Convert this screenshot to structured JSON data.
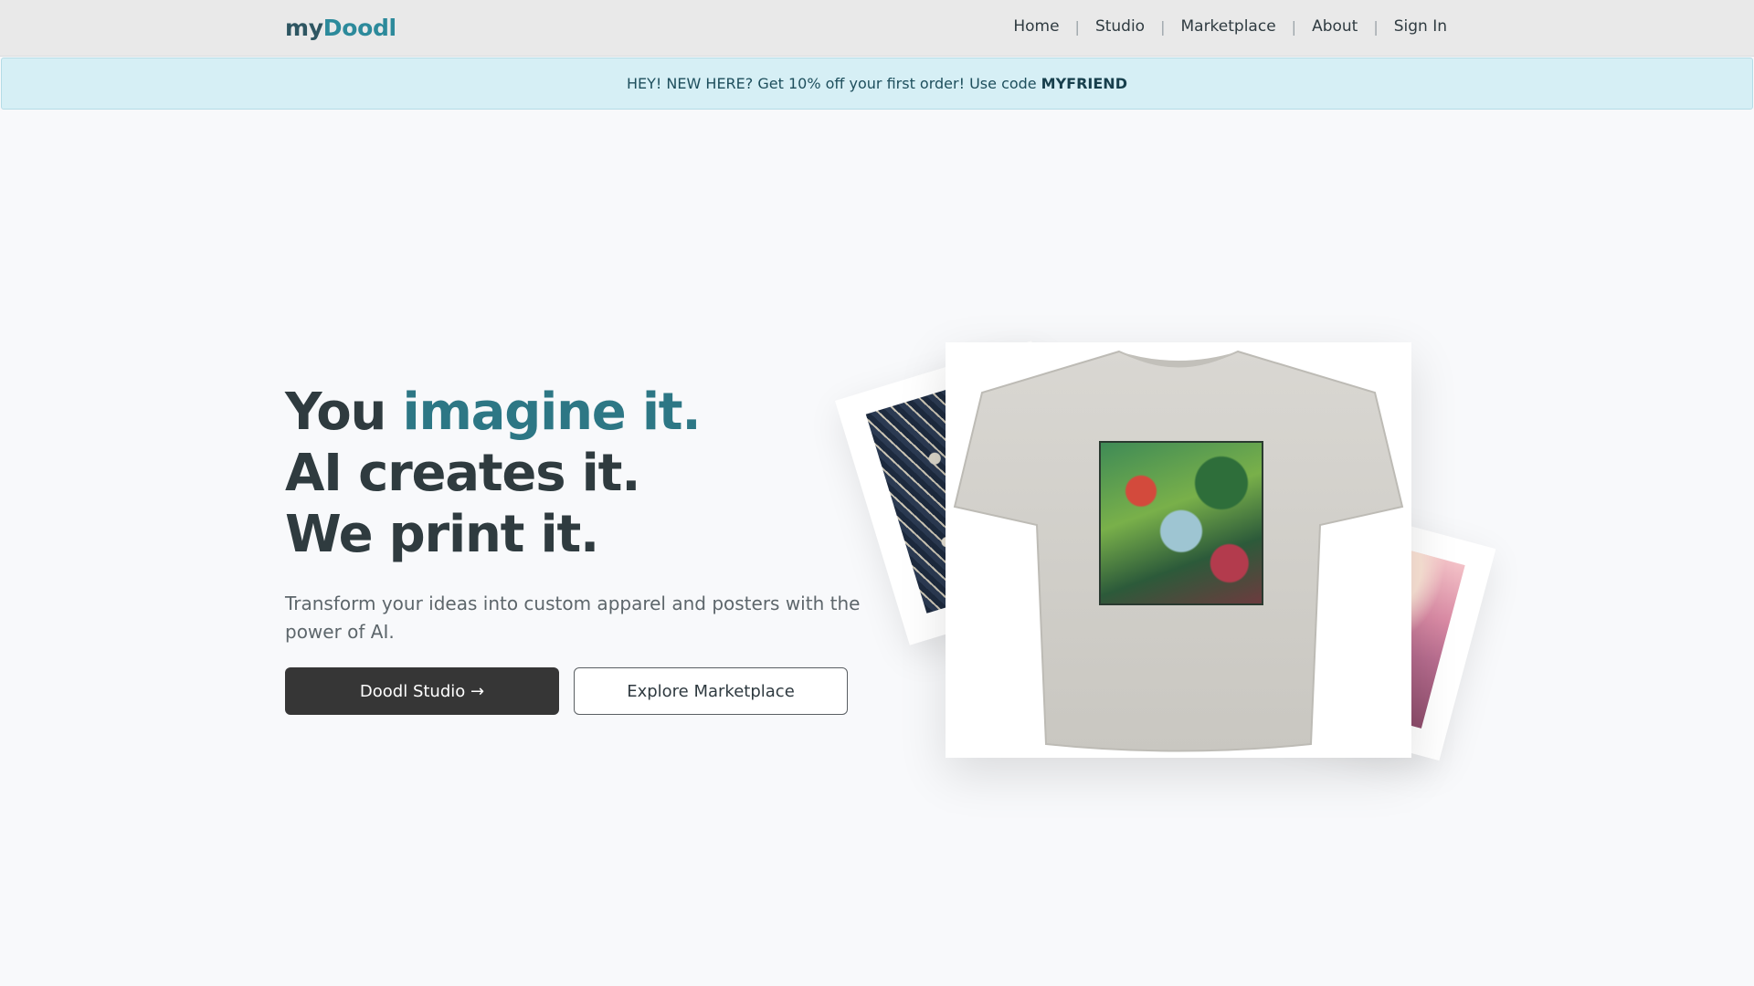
{
  "header": {
    "logo_part1": "my",
    "logo_part2": "Doodl",
    "nav": [
      "Home",
      "Studio",
      "Marketplace",
      "About",
      "Sign In"
    ]
  },
  "promo": {
    "text": "HEY! NEW HERE? Get 10% off your first order! Use code",
    "code": "MYFRIEND"
  },
  "hero": {
    "line1_a": "You ",
    "line1_b": "imagine it.",
    "line2": "AI creates it.",
    "line3": "We print it.",
    "subtitle": "Transform your ideas into custom apparel and posters with the power of AI.",
    "primary_button": "Doodl Studio →",
    "secondary_button": "Explore Marketplace"
  },
  "colors": {
    "accent": "#2d7785",
    "brand": "#2c8a9b",
    "promo_bg": "#d6eff5",
    "primary_button": "#363636"
  }
}
